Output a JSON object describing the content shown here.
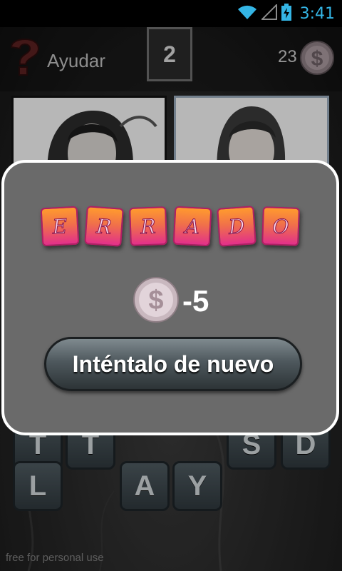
{
  "status_bar": {
    "time": "3:41"
  },
  "header": {
    "help_label": "Ayudar",
    "level": "2",
    "coins": "23"
  },
  "keyboard": {
    "partial_keys": [
      "T",
      "T",
      "S",
      "D"
    ],
    "keys": [
      "L",
      "A",
      "Y"
    ]
  },
  "watermark": "free for personal use",
  "dialog": {
    "result_letters": [
      "E",
      "R",
      "R",
      "A",
      "D",
      "O"
    ],
    "penalty": "-5",
    "retry_label": "Inténtalo de nuevo"
  },
  "colors": {
    "tile_top": "#ff9a2e",
    "tile_bottom": "#e2308a",
    "status_accent": "#34b5e5"
  }
}
